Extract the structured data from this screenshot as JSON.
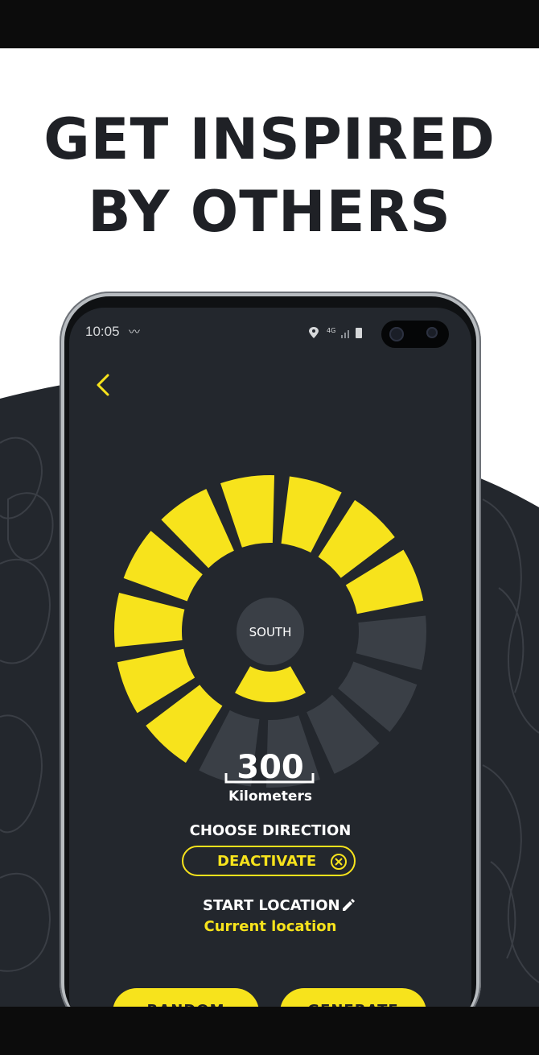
{
  "headline": {
    "line1": "GET INSPIRED",
    "line2": "BY OTHERS"
  },
  "status": {
    "time": "10:05",
    "network": "4G"
  },
  "dial": {
    "direction_label": "SOUTH",
    "segments_total": 14,
    "active_segments": [
      0,
      1,
      2,
      3,
      4,
      5,
      6,
      7,
      8
    ],
    "active_color": "#f7e31c",
    "inactive_color": "#3a3f46"
  },
  "distance": {
    "value": "300",
    "unit": "Kilometers"
  },
  "choose_direction": {
    "title": "CHOOSE DIRECTION",
    "button": "DEACTIVATE"
  },
  "start": {
    "title": "START LOCATION",
    "value": "Current location"
  },
  "actions": {
    "random": "RANDOM",
    "generate": "GENERATE"
  },
  "colors": {
    "accent": "#f7e31c",
    "screen_bg": "#23272d",
    "text_dark": "#1f2126"
  },
  "icons": [
    "back-chevron-icon",
    "location-pin-icon",
    "signal-icon",
    "battery-icon",
    "close-circle-icon",
    "pencil-icon"
  ]
}
